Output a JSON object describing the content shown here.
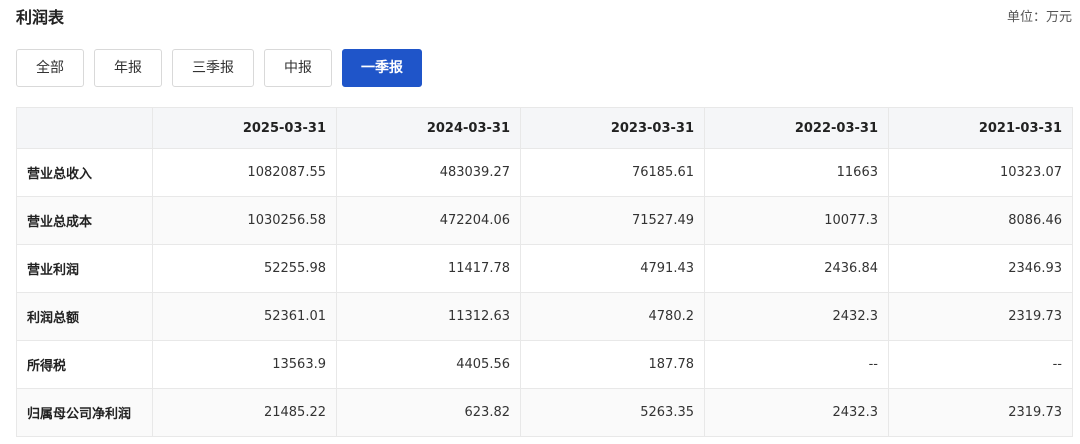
{
  "header": {
    "title": "利润表",
    "unit": "单位：万元"
  },
  "tabs": [
    {
      "label": "全部",
      "active": false
    },
    {
      "label": "年报",
      "active": false
    },
    {
      "label": "三季报",
      "active": false
    },
    {
      "label": "中报",
      "active": false
    },
    {
      "label": "一季报",
      "active": true
    }
  ],
  "table": {
    "columns": [
      "",
      "2025-03-31",
      "2024-03-31",
      "2023-03-31",
      "2022-03-31",
      "2021-03-31"
    ],
    "rows": [
      {
        "label": "营业总收入",
        "values": [
          "1082087.55",
          "483039.27",
          "76185.61",
          "11663",
          "10323.07"
        ]
      },
      {
        "label": "营业总成本",
        "values": [
          "1030256.58",
          "472204.06",
          "71527.49",
          "10077.3",
          "8086.46"
        ]
      },
      {
        "label": "营业利润",
        "values": [
          "52255.98",
          "11417.78",
          "4791.43",
          "2436.84",
          "2346.93"
        ]
      },
      {
        "label": "利润总额",
        "values": [
          "52361.01",
          "11312.63",
          "4780.2",
          "2432.3",
          "2319.73"
        ]
      },
      {
        "label": "所得税",
        "values": [
          "13563.9",
          "4405.56",
          "187.78",
          "--",
          "--"
        ]
      },
      {
        "label": "归属母公司净利润",
        "values": [
          "21485.22",
          "623.82",
          "5263.35",
          "2432.3",
          "2319.73"
        ]
      }
    ]
  },
  "colors": {
    "accent": "#1f55c9",
    "header_bg": "#f5f6f8",
    "border": "#e8e8e8"
  }
}
